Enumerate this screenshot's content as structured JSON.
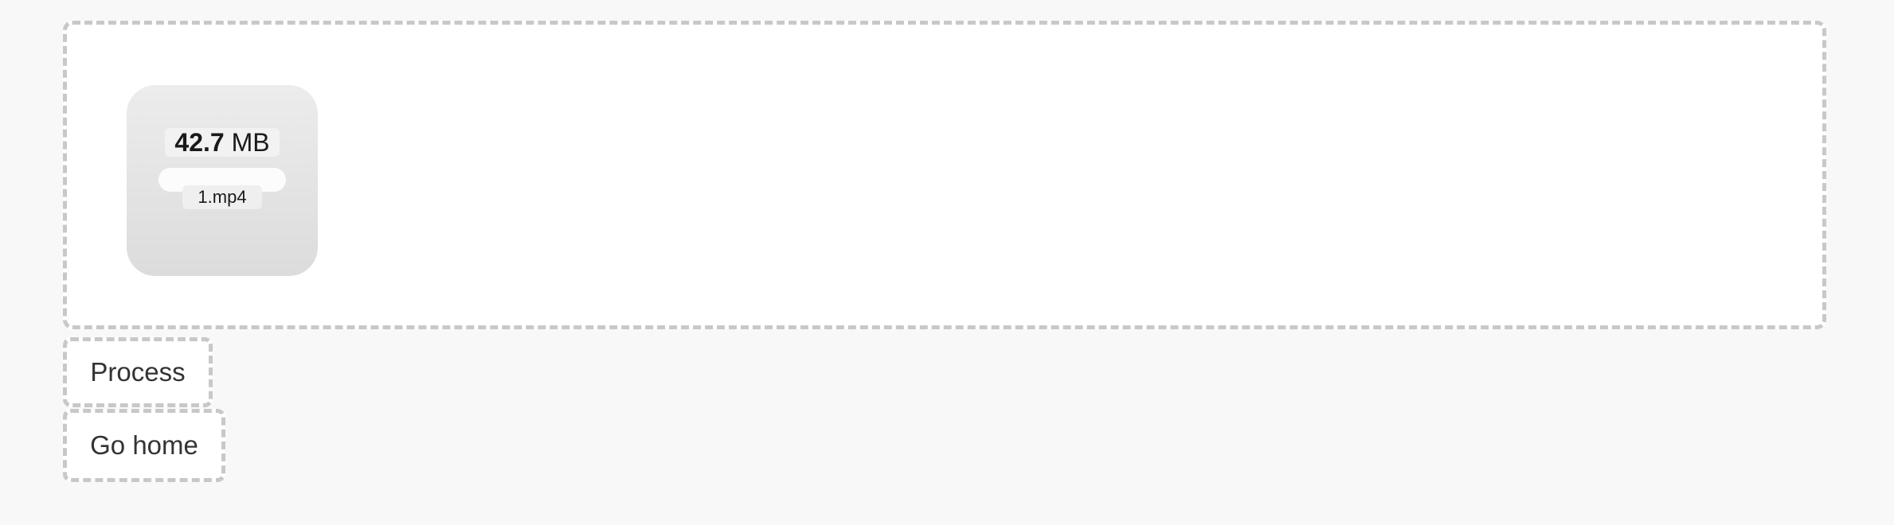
{
  "dropzone": {
    "file": {
      "size_value": "42.7",
      "size_unit": "MB",
      "name": "1.mp4",
      "progress_percent": 0
    }
  },
  "actions": {
    "process_label": "Process",
    "home_label": "Go home"
  },
  "colors": {
    "background": "#f8f8f8",
    "dashed_border": "#c8c8c8",
    "card_top": "#ececec",
    "card_bottom": "#dcdcdc",
    "text": "#333333"
  }
}
